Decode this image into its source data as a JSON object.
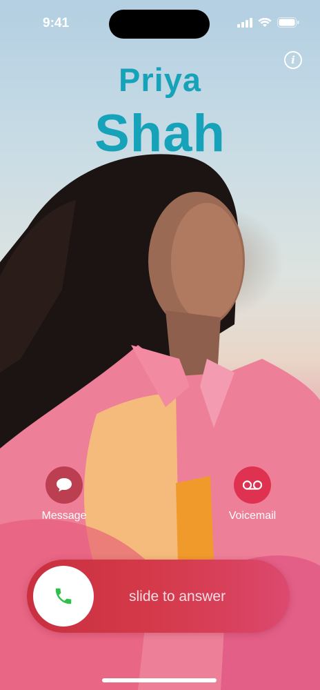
{
  "status_bar": {
    "time": "9:41",
    "icons": [
      "signal-icon",
      "wifi-icon",
      "battery-icon"
    ]
  },
  "caller": {
    "first_name": "Priya",
    "last_name": "Shah",
    "name_color": "#16a2b8"
  },
  "info_button": {
    "icon": "info-icon",
    "glyph": "i"
  },
  "actions": {
    "message": {
      "label": "Message",
      "icon": "message-bubble-icon"
    },
    "voicemail": {
      "label": "Voicemail",
      "icon": "voicemail-icon"
    }
  },
  "slider": {
    "label": "slide to answer",
    "icon": "phone-icon",
    "accent": "#2fbf4a"
  }
}
